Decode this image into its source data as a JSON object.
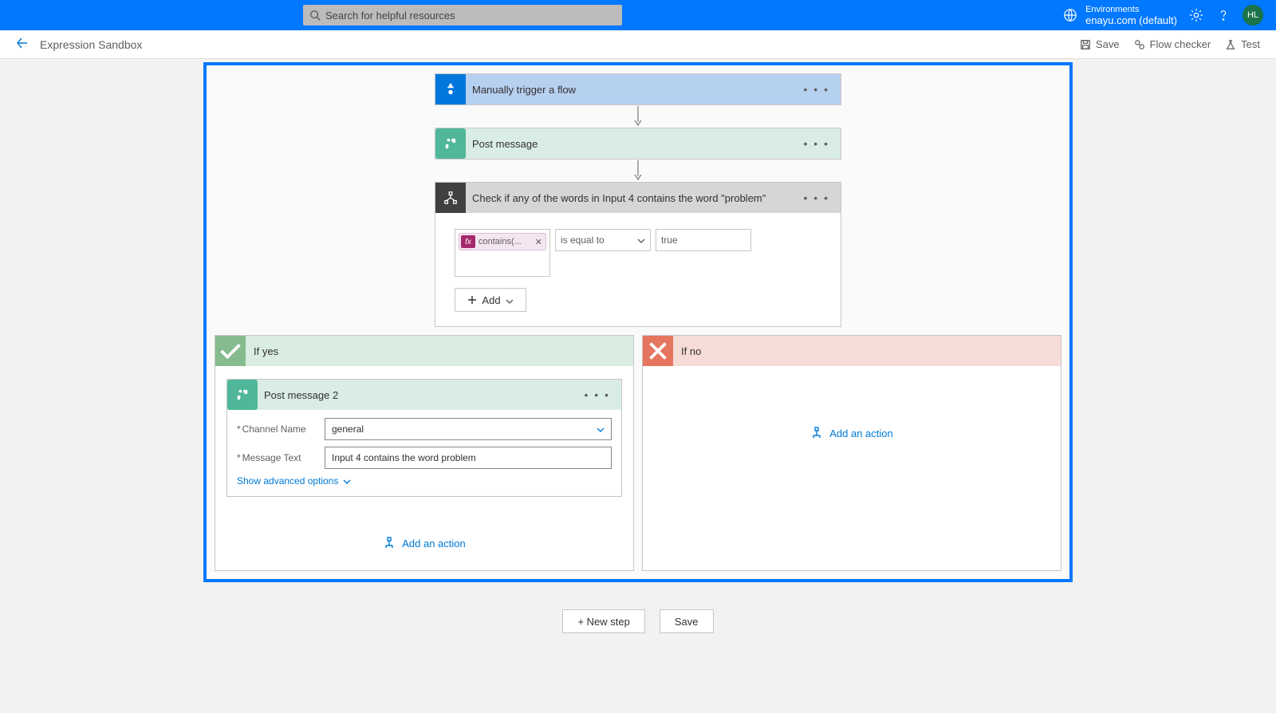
{
  "topbar": {
    "search_placeholder": "Search for helpful resources",
    "env_label": "Environments",
    "env_name": "enayu.com (default)",
    "avatar_initials": "HL"
  },
  "cmdbar": {
    "title": "Expression Sandbox",
    "save": "Save",
    "flow_checker": "Flow checker",
    "test": "Test"
  },
  "flow": {
    "trigger": {
      "title": "Manually trigger a flow"
    },
    "step1": {
      "title": "Post message"
    },
    "condition": {
      "title": "Check if any of the words in Input 4 contains the word \"problem\"",
      "token_label": "contains(...",
      "operator": "is equal to",
      "value": "true",
      "add_label": "Add"
    },
    "if_yes": {
      "title": "If yes",
      "action": {
        "title": "Post message 2",
        "channel_label": "Channel Name",
        "channel_value": "general",
        "message_label": "Message Text",
        "message_value": "Input 4 contains the word problem",
        "advanced": "Show advanced options"
      },
      "add_action": "Add an action"
    },
    "if_no": {
      "title": "If no",
      "add_action": "Add an action"
    }
  },
  "bottom": {
    "new_step": "+ New step",
    "save": "Save"
  }
}
